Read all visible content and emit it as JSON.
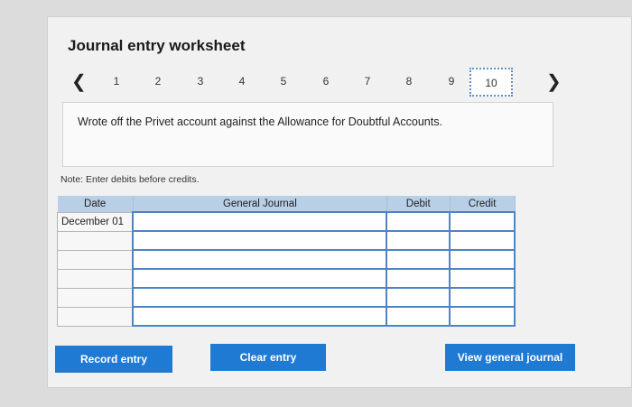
{
  "worksheet": {
    "title": "Journal entry worksheet",
    "pages": [
      "1",
      "2",
      "3",
      "4",
      "5",
      "6",
      "7",
      "8",
      "9",
      "10"
    ],
    "active_page": "10",
    "prev_icon": "chevron-left-icon",
    "next_icon": "chevron-right-icon",
    "description": "Wrote off the Privet account against the Allowance for Doubtful Accounts.",
    "note": "Note: Enter debits before credits."
  },
  "table": {
    "headers": {
      "date": "Date",
      "general_journal": "General Journal",
      "debit": "Debit",
      "credit": "Credit"
    },
    "rows": [
      {
        "date": "December 01",
        "account": "",
        "debit": "",
        "credit": ""
      },
      {
        "date": "",
        "account": "",
        "debit": "",
        "credit": ""
      },
      {
        "date": "",
        "account": "",
        "debit": "",
        "credit": ""
      },
      {
        "date": "",
        "account": "",
        "debit": "",
        "credit": ""
      },
      {
        "date": "",
        "account": "",
        "debit": "",
        "credit": ""
      },
      {
        "date": "",
        "account": "",
        "debit": "",
        "credit": ""
      }
    ]
  },
  "buttons": {
    "record": "Record entry",
    "clear": "Clear entry",
    "view": "View general journal"
  },
  "colors": {
    "button": "#1f7ad4",
    "header": "#b9cfe6",
    "input_border": "#4d84c4"
  }
}
